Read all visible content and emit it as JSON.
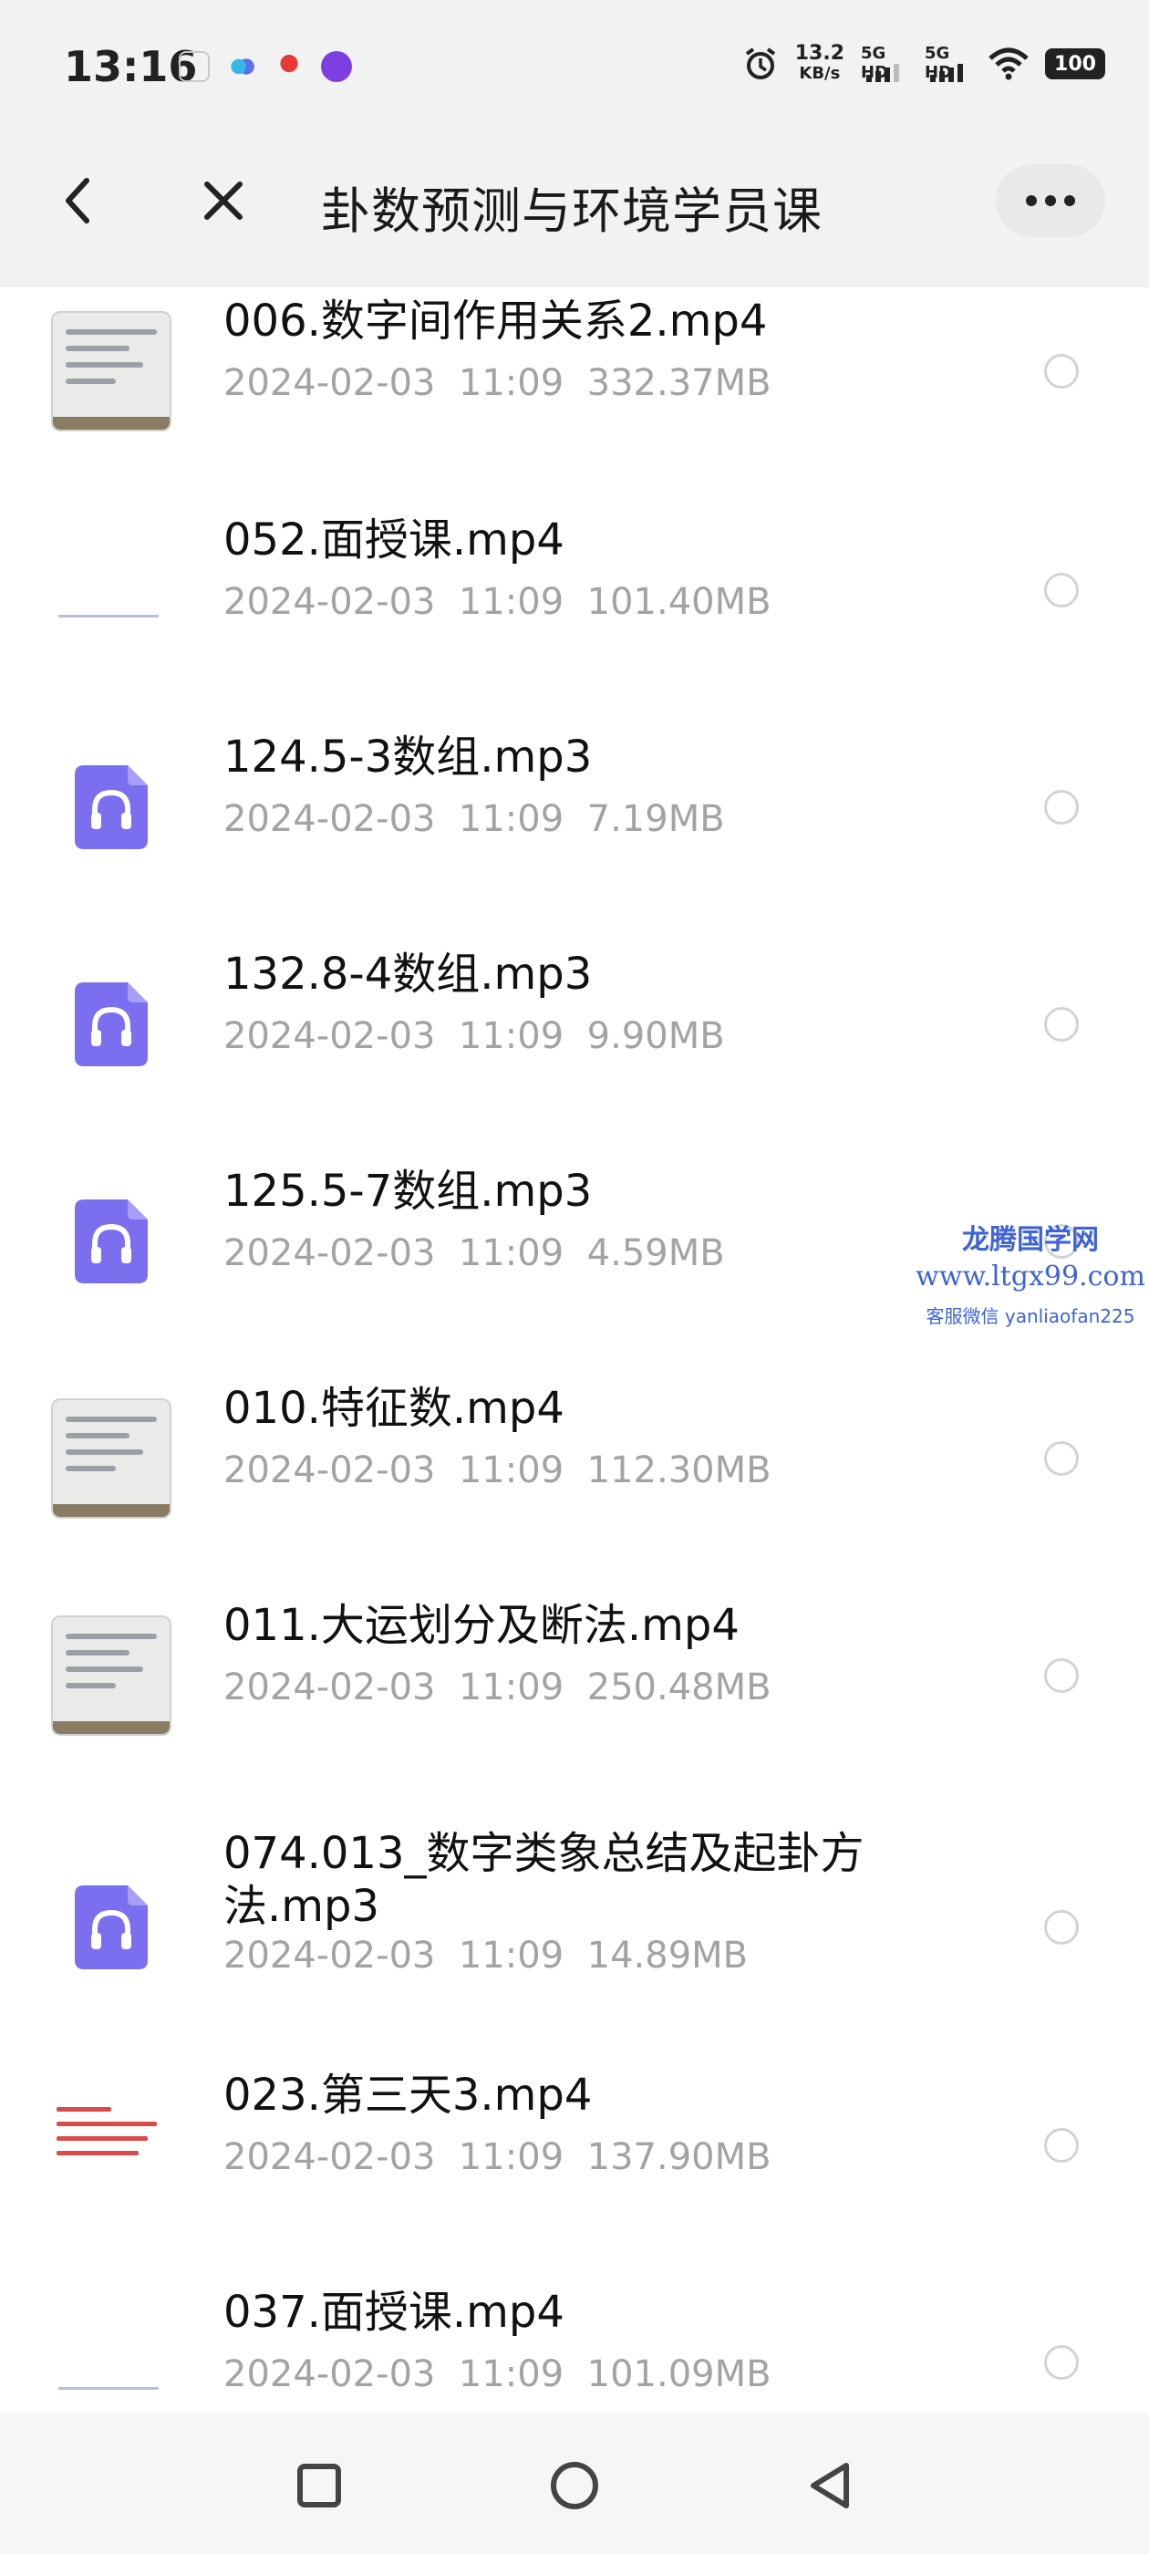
{
  "status_bar": {
    "time": "13:16",
    "speed_value": "13.2",
    "speed_unit": "KB/s",
    "sim1": "5G HD",
    "sim2": "5G HD",
    "battery": "100"
  },
  "header": {
    "title": "卦数预测与环境学员课",
    "back_icon": "chevron-left-icon",
    "close_icon": "close-icon",
    "more_icon": "more-dots-icon"
  },
  "files": [
    {
      "name": "006.数字间作用关系2.mp4",
      "date": "2024-02-03",
      "time": "11:09",
      "size": "332.37MB",
      "thumb": "board"
    },
    {
      "name": "052.面授课.mp4",
      "date": "2024-02-03",
      "time": "11:09",
      "size": "101.40MB",
      "thumb": "slide"
    },
    {
      "name": "124.5-3数组.mp3",
      "date": "2024-02-03",
      "time": "11:09",
      "size": "7.19MB",
      "thumb": "audio"
    },
    {
      "name": "132.8-4数组.mp3",
      "date": "2024-02-03",
      "time": "11:09",
      "size": "9.90MB",
      "thumb": "audio"
    },
    {
      "name": "125.5-7数组.mp3",
      "date": "2024-02-03",
      "time": "11:09",
      "size": "4.59MB",
      "thumb": "audio"
    },
    {
      "name": "010.特征数.mp4",
      "date": "2024-02-03",
      "time": "11:09",
      "size": "112.30MB",
      "thumb": "board"
    },
    {
      "name": "011.大运划分及断法.mp4",
      "date": "2024-02-03",
      "time": "11:09",
      "size": "250.48MB",
      "thumb": "board"
    },
    {
      "name": "074.013_数字类象总结及起卦方法.mp3",
      "date": "2024-02-03",
      "time": "11:09",
      "size": "14.89MB",
      "thumb": "audio"
    },
    {
      "name": "023.第三天3.mp4",
      "date": "2024-02-03",
      "time": "11:09",
      "size": "137.90MB",
      "thumb": "text"
    },
    {
      "name": "037.面授课.mp4",
      "date": "2024-02-03",
      "time": "11:09",
      "size": "101.09MB",
      "thumb": "slide"
    }
  ],
  "watermark": {
    "line1": "龙腾国学网",
    "line2": "www.ltgx99.com",
    "line3": "客服微信 yanliaofan225"
  },
  "nav": {
    "recents_icon": "square-icon",
    "home_icon": "circle-icon",
    "back_icon": "triangle-back-icon"
  },
  "colors": {
    "audio_accent": "#7b6ff0",
    "meta_text": "#a3a3a6",
    "header_bg": "#f2f2f3"
  }
}
